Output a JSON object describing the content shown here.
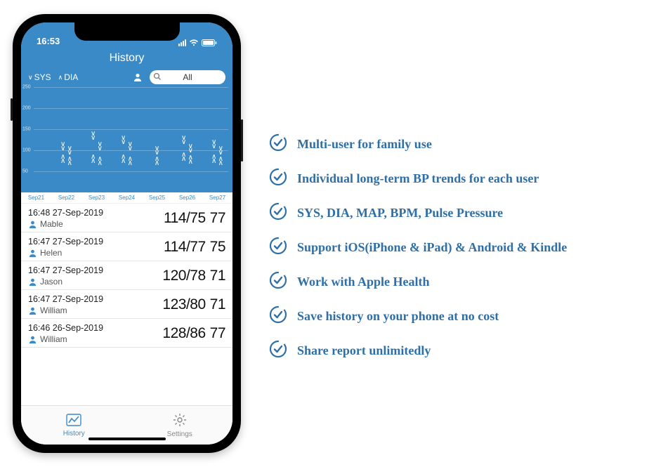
{
  "status_bar": {
    "time": "16:53"
  },
  "app": {
    "title": "History",
    "legend": {
      "sys": "SYS",
      "dia": "DIA"
    },
    "search": {
      "value": "All"
    }
  },
  "chart_data": {
    "type": "scatter",
    "title": "",
    "xlabel": "",
    "ylabel": "",
    "ylim": [
      0,
      250
    ],
    "y_ticks": [
      50,
      100,
      150,
      200,
      250
    ],
    "x_categories": [
      "Sep21",
      "Sep22",
      "Sep23",
      "Sep24",
      "Sep25",
      "Sep26",
      "Sep27"
    ],
    "series": [
      {
        "name": "SYS",
        "marker": "down_chevrons",
        "points": [
          {
            "x": "Sep22",
            "y": 110
          },
          {
            "x": "Sep22",
            "y": 100
          },
          {
            "x": "Sep23",
            "y": 135
          },
          {
            "x": "Sep23",
            "y": 110
          },
          {
            "x": "Sep24",
            "y": 125
          },
          {
            "x": "Sep24",
            "y": 110
          },
          {
            "x": "Sep25",
            "y": 100
          },
          {
            "x": "Sep26",
            "y": 125
          },
          {
            "x": "Sep26",
            "y": 105
          },
          {
            "x": "Sep27",
            "y": 115
          },
          {
            "x": "Sep27",
            "y": 100
          }
        ]
      },
      {
        "name": "DIA",
        "marker": "up_chevrons",
        "points": [
          {
            "x": "Sep22",
            "y": 80
          },
          {
            "x": "Sep22",
            "y": 75
          },
          {
            "x": "Sep23",
            "y": 80
          },
          {
            "x": "Sep23",
            "y": 75
          },
          {
            "x": "Sep24",
            "y": 80
          },
          {
            "x": "Sep24",
            "y": 75
          },
          {
            "x": "Sep25",
            "y": 75
          },
          {
            "x": "Sep26",
            "y": 85
          },
          {
            "x": "Sep26",
            "y": 78
          },
          {
            "x": "Sep27",
            "y": 80
          },
          {
            "x": "Sep27",
            "y": 75
          }
        ]
      }
    ]
  },
  "records": [
    {
      "time": "16:48 27-Sep-2019",
      "user": "Mable",
      "sys": 114,
      "dia": 75,
      "pulse": 77
    },
    {
      "time": "16:47 27-Sep-2019",
      "user": "Helen",
      "sys": 114,
      "dia": 77,
      "pulse": 75
    },
    {
      "time": "16:47 27-Sep-2019",
      "user": "Jason",
      "sys": 120,
      "dia": 78,
      "pulse": 71
    },
    {
      "time": "16:47 27-Sep-2019",
      "user": "William",
      "sys": 123,
      "dia": 80,
      "pulse": 71
    },
    {
      "time": "16:46 26-Sep-2019",
      "user": "William",
      "sys": 128,
      "dia": 86,
      "pulse": 77
    }
  ],
  "tabs": {
    "history": "History",
    "settings": "Settings"
  },
  "features": [
    "Multi-user for family use",
    "Individual long-term BP trends for each user",
    "SYS, DIA, MAP, BPM, Pulse Pressure",
    "Support iOS(iPhone & iPad) & Android & Kindle",
    "Work with Apple Health",
    "Save history on your phone at no cost",
    "Share report unlimitedly"
  ],
  "colors": {
    "brand": "#2f6fa8",
    "app": "#3a8ac8"
  }
}
